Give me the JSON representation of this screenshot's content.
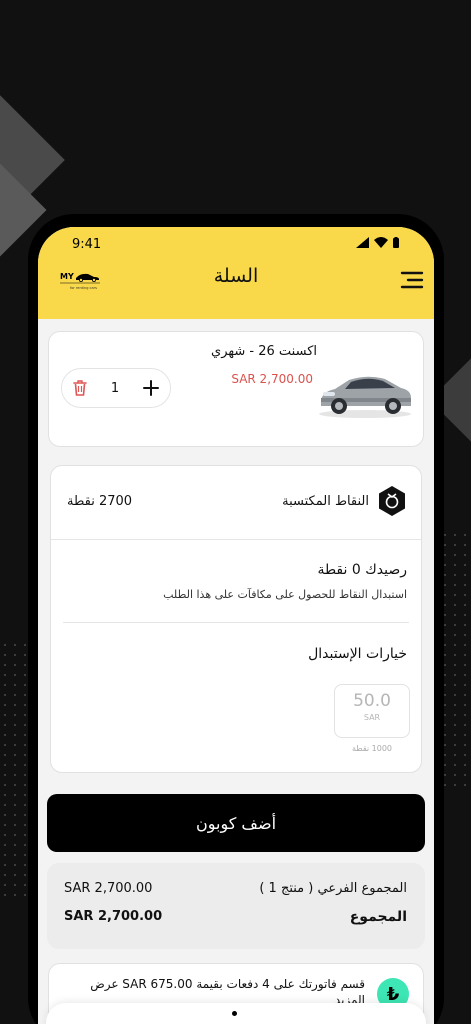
{
  "status_bar": {
    "time": "9:41"
  },
  "header": {
    "title": "السلة",
    "logo_text": "MY",
    "logo_sub": "for renting cars"
  },
  "cart_item": {
    "title": "اكسنت 26 - شهري",
    "price": "SAR 2,700.00",
    "quantity": "1",
    "image": "car-image"
  },
  "points": {
    "label": "النقاط المكتسبة",
    "value": "2700 نقطة",
    "balance_title": "رصيدك 0 نقطة",
    "balance_sub": "استبدال النقاط للحصول على مكافآت على هذا الطلب",
    "redeem_title": "خيارات الإستبدال",
    "options": [
      {
        "amount": "50.0",
        "currency": "SAR",
        "points": "1000 نقطة"
      }
    ]
  },
  "coupon": {
    "label": "أضف كوبون"
  },
  "totals": {
    "subtotal_label": "المجموع الفرعي ( منتج 1 )",
    "subtotal_value": "SAR 2,700.00",
    "total_label": "المجموع",
    "total_value": "SAR 2,700.00"
  },
  "installment": {
    "icon_text": "₺",
    "text": "قسم فاتورتك على 4 دفعات بقيمة SAR 675.00 عرض المزيد"
  },
  "colors": {
    "header_bg": "#f9d94a",
    "price": "#d9534f",
    "coupon_bg": "#000000",
    "tabby": "#3de6b4"
  }
}
